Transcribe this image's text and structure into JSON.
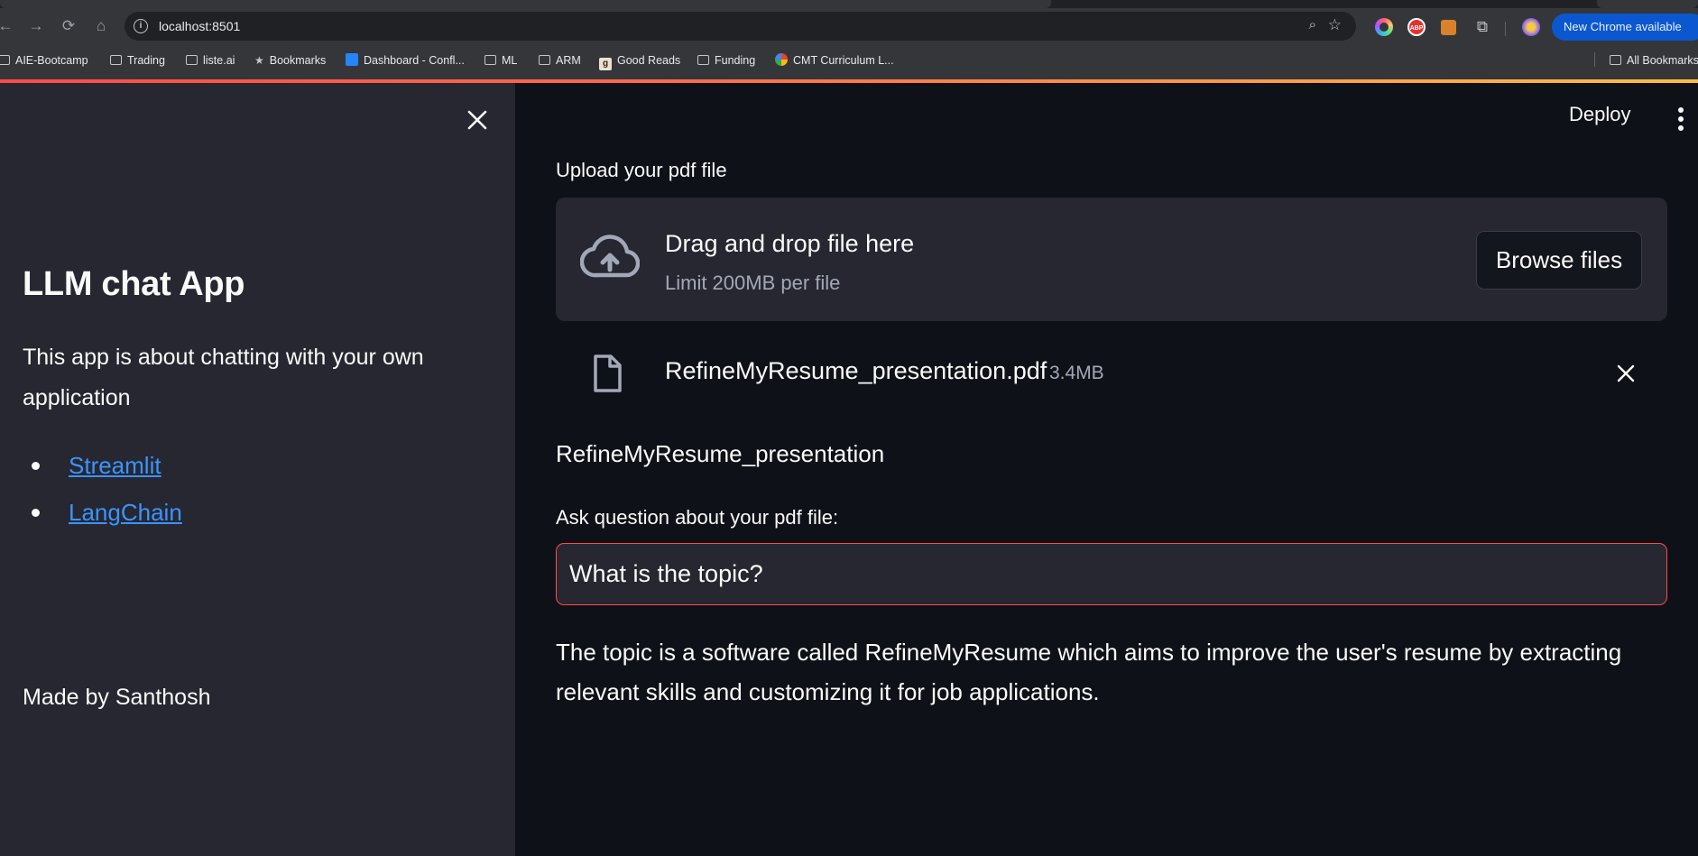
{
  "browser": {
    "url": "localhost:8501",
    "update_label": "New Chrome available",
    "bookmarks": [
      {
        "label": "AIE-Bootcamp",
        "icon": "folder-icon"
      },
      {
        "label": "Trading",
        "icon": "folder-icon"
      },
      {
        "label": "liste.ai",
        "icon": "folder-icon"
      },
      {
        "label": "Bookmarks",
        "icon": "star-icon"
      },
      {
        "label": "Dashboard - Confl...",
        "icon": "confluence-icon"
      },
      {
        "label": "ML",
        "icon": "folder-icon"
      },
      {
        "label": "ARM",
        "icon": "folder-icon"
      },
      {
        "label": "Good Reads",
        "icon": "goodreads-icon"
      },
      {
        "label": "Funding",
        "icon": "folder-icon"
      },
      {
        "label": "CMT Curriculum L...",
        "icon": "google-icon"
      },
      {
        "label": "All Bookmarks",
        "icon": "folder-icon"
      }
    ]
  },
  "sidebar": {
    "title": "LLM chat App",
    "description": "This app is about chatting with your own application",
    "links": [
      {
        "label": "Streamlit"
      },
      {
        "label": "LangChain"
      }
    ],
    "footer": "Made by Santhosh"
  },
  "main": {
    "deploy_label": "Deploy",
    "upload_label": "Upload your pdf file",
    "dropzone": {
      "title": "Drag and drop file here",
      "limit": "Limit 200MB per file",
      "browse_label": "Browse files"
    },
    "file": {
      "name": "RefineMyResume_presentation.pdf",
      "size": "3.4MB"
    },
    "document_title": "RefineMyResume_presentation",
    "question_label": "Ask question about your pdf file:",
    "question_value": "What is the topic?",
    "answer": "The topic is a software called RefineMyResume which aims to improve the user's resume by extracting relevant skills and customizing it for job applications."
  },
  "colors": {
    "sidebar_bg": "#262730",
    "main_bg": "#0e1117",
    "accent": "#ff4b4b",
    "link": "#3b94ff"
  }
}
